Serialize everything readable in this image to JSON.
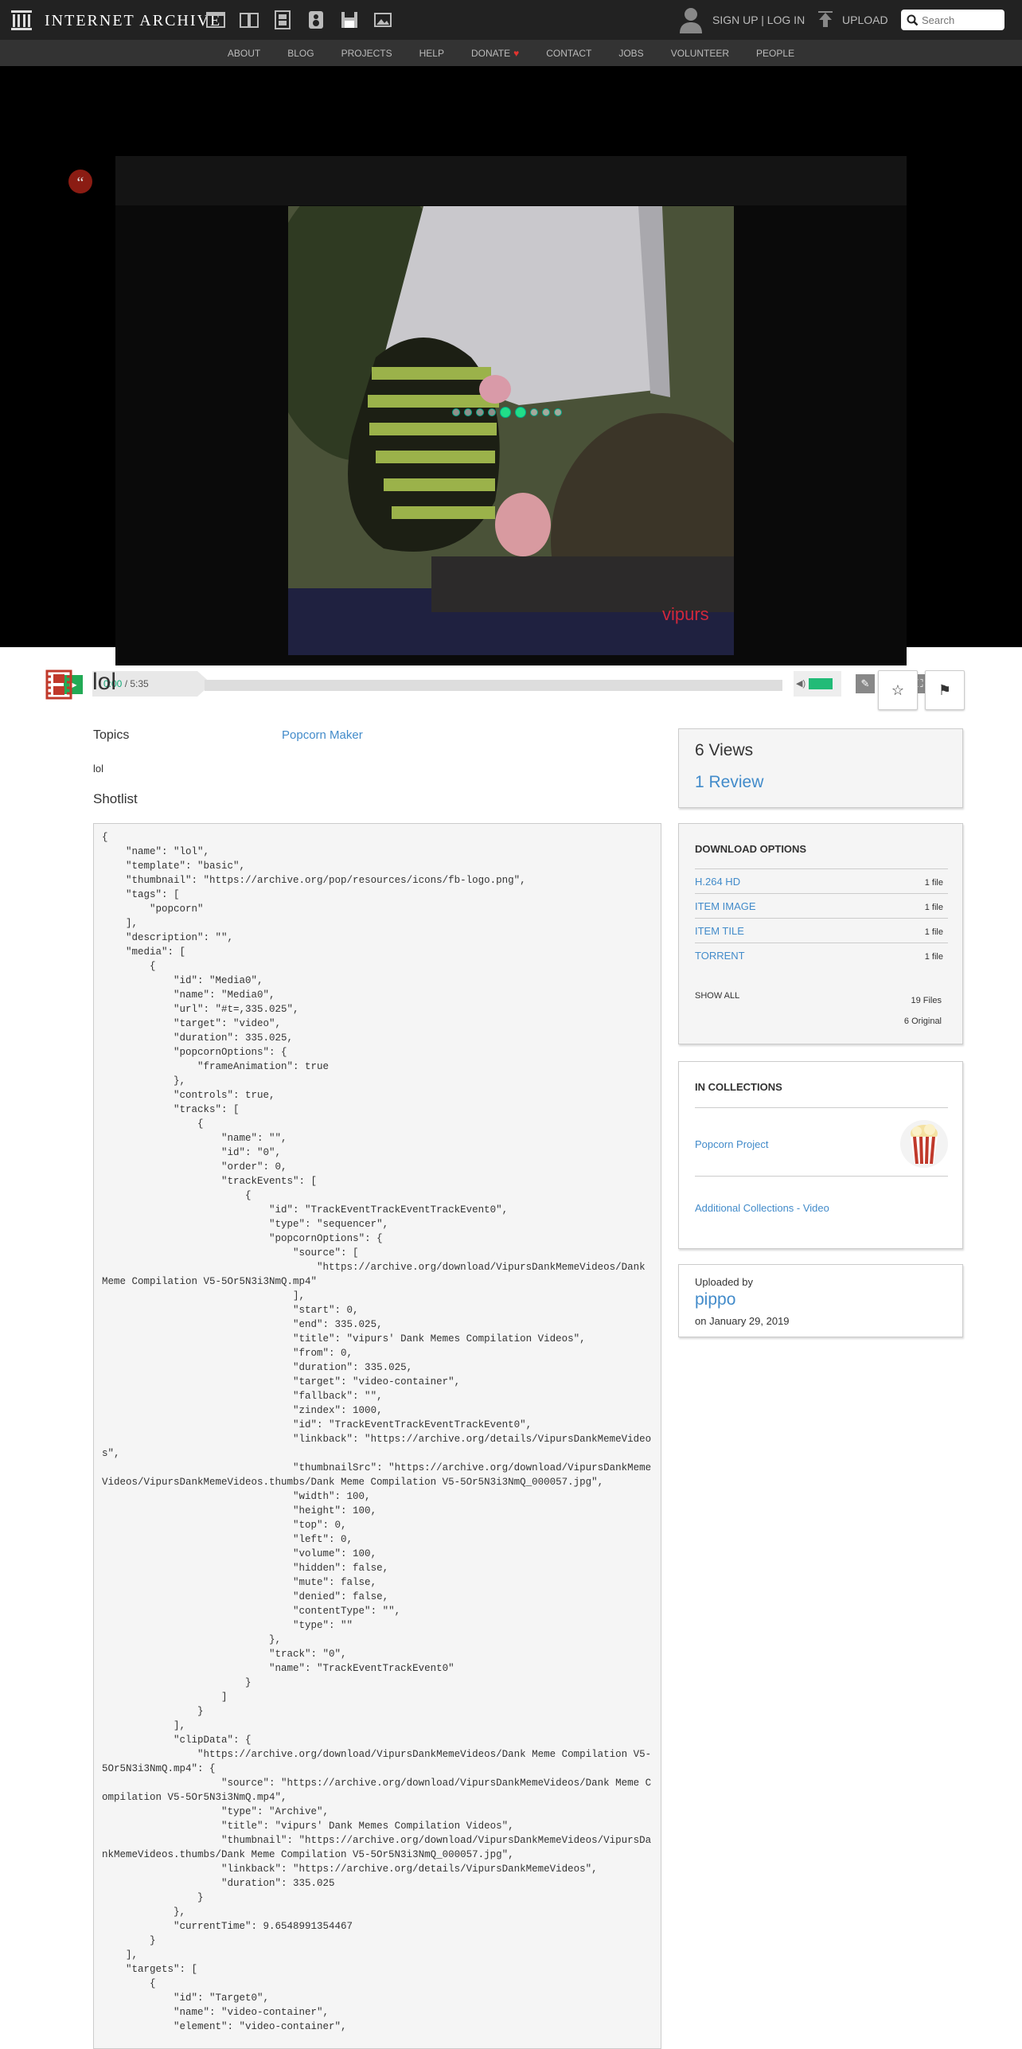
{
  "header": {
    "brand": "INTERNET ARCHIVE",
    "auth": "SIGN UP | LOG IN",
    "upload": "UPLOAD",
    "search_placeholder": "Search",
    "media_icons": [
      "web-icon",
      "texts-icon",
      "video-icon",
      "audio-icon",
      "software-icon",
      "images-icon"
    ]
  },
  "nav": {
    "items": [
      "ABOUT",
      "BLOG",
      "PROJECTS",
      "HELP",
      "DONATE",
      "CONTACT",
      "JOBS",
      "VOLUNTEER",
      "PEOPLE"
    ]
  },
  "player": {
    "current_time": "0:00",
    "duration": "/ 5:35",
    "brand_color": "#22aa55"
  },
  "item": {
    "title": "lol",
    "topics_label": "Topics",
    "topics_value": "Popcorn Maker",
    "description": "lol",
    "shotlist_label": "Shotlist",
    "shotlist_code": "{\n    \"name\": \"lol\",\n    \"template\": \"basic\",\n    \"thumbnail\": \"https://archive.org/pop/resources/icons/fb-logo.png\",\n    \"tags\": [\n        \"popcorn\"\n    ],\n    \"description\": \"\",\n    \"media\": [\n        {\n            \"id\": \"Media0\",\n            \"name\": \"Media0\",\n            \"url\": \"#t=,335.025\",\n            \"target\": \"video\",\n            \"duration\": 335.025,\n            \"popcornOptions\": {\n                \"frameAnimation\": true\n            },\n            \"controls\": true,\n            \"tracks\": [\n                {\n                    \"name\": \"\",\n                    \"id\": \"0\",\n                    \"order\": 0,\n                    \"trackEvents\": [\n                        {\n                            \"id\": \"TrackEventTrackEventTrackEvent0\",\n                            \"type\": \"sequencer\",\n                            \"popcornOptions\": {\n                                \"source\": [\n                                    \"https://archive.org/download/VipursDankMemeVideos/Dank Meme Compilation V5-5Or5N3i3NmQ.mp4\"\n                                ],\n                                \"start\": 0,\n                                \"end\": 335.025,\n                                \"title\": \"vipurs' Dank Memes Compilation Videos\",\n                                \"from\": 0,\n                                \"duration\": 335.025,\n                                \"target\": \"video-container\",\n                                \"fallback\": \"\",\n                                \"zindex\": 1000,\n                                \"id\": \"TrackEventTrackEventTrackEvent0\",\n                                \"linkback\": \"https://archive.org/details/VipursDankMemeVideos\",\n                                \"thumbnailSrc\": \"https://archive.org/download/VipursDankMemeVideos/VipursDankMemeVideos.thumbs/Dank Meme Compilation V5-5Or5N3i3NmQ_000057.jpg\",\n                                \"width\": 100,\n                                \"height\": 100,\n                                \"top\": 0,\n                                \"left\": 0,\n                                \"volume\": 100,\n                                \"hidden\": false,\n                                \"mute\": false,\n                                \"denied\": false,\n                                \"contentType\": \"\",\n                                \"type\": \"\"\n                            },\n                            \"track\": \"0\",\n                            \"name\": \"TrackEventTrackEvent0\"\n                        }\n                    ]\n                }\n            ],\n            \"clipData\": {\n                \"https://archive.org/download/VipursDankMemeVideos/Dank Meme Compilation V5-5Or5N3i3NmQ.mp4\": {\n                    \"source\": \"https://archive.org/download/VipursDankMemeVideos/Dank Meme Compilation V5-5Or5N3i3NmQ.mp4\",\n                    \"type\": \"Archive\",\n                    \"title\": \"vipurs' Dank Memes Compilation Videos\",\n                    \"thumbnail\": \"https://archive.org/download/VipursDankMemeVideos/VipursDankMemeVideos.thumbs/Dank Meme Compilation V5-5Or5N3i3NmQ_000057.jpg\",\n                    \"linkback\": \"https://archive.org/details/VipursDankMemeVideos\",\n                    \"duration\": 335.025\n                }\n            },\n            \"currentTime\": 9.6548991354467\n        }\n    ],\n    \"targets\": [\n        {\n            \"id\": \"Target0\",\n            \"name\": \"video-container\",\n            \"element\": \"video-container\","
  },
  "sidebar": {
    "views": "6 Views",
    "reviews": "1 Review",
    "download_heading": "DOWNLOAD OPTIONS",
    "downloads": [
      {
        "name": "H.264 HD",
        "count": "1 file"
      },
      {
        "name": "ITEM IMAGE",
        "count": "1 file"
      },
      {
        "name": "ITEM TILE",
        "count": "1 file"
      },
      {
        "name": "TORRENT",
        "count": "1 file"
      }
    ],
    "show_all": "SHOW ALL",
    "files_total": "19 Files",
    "files_original": "6 Original",
    "collections_heading": "IN COLLECTIONS",
    "collections": [
      "Popcorn Project",
      "Additional Collections - Video"
    ],
    "uploaded_by_label": "Uploaded by",
    "uploader": "pippo",
    "upload_date": "on January 29, 2019"
  }
}
